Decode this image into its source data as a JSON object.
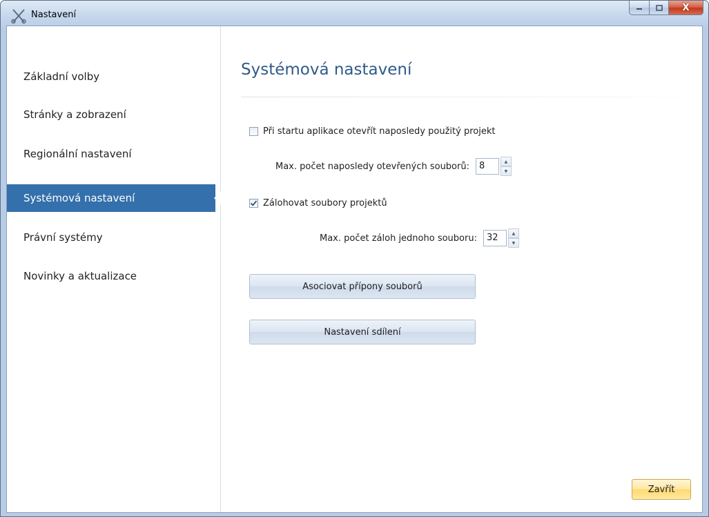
{
  "window": {
    "title": "Nastavení",
    "icon": "scissors-icon",
    "controls": {
      "close_label": "X"
    }
  },
  "sidebar": {
    "items": [
      {
        "label": "Základní volby",
        "active": false
      },
      {
        "label": "Stránky a zobrazení",
        "active": false
      },
      {
        "label": "Regionální nastavení",
        "active": false
      },
      {
        "label": "Systémová nastavení",
        "active": true
      },
      {
        "label": "Právní systémy",
        "active": false
      },
      {
        "label": "Novinky a aktualizace",
        "active": false
      }
    ]
  },
  "main": {
    "title": "Systémová nastavení",
    "open_last_project": {
      "label": "Při startu aplikace otevřít naposledy použitý projekt",
      "checked": false
    },
    "max_recent_files": {
      "label": "Max. počet naposledy otevřených souborů:",
      "value": "8"
    },
    "backup_projects": {
      "label": "Zálohovat soubory projektů",
      "checked": true
    },
    "max_backups": {
      "label": "Max. počet záloh jednoho souboru:",
      "value": "32"
    },
    "associate_button": "Asociovat přípony souborů",
    "sharing_button": "Nastavení sdílení",
    "close_button": "Zavřít"
  },
  "colors": {
    "accent": "#3470ab",
    "title_text": "#2f5a8a",
    "close_button": "#ffd96b"
  }
}
